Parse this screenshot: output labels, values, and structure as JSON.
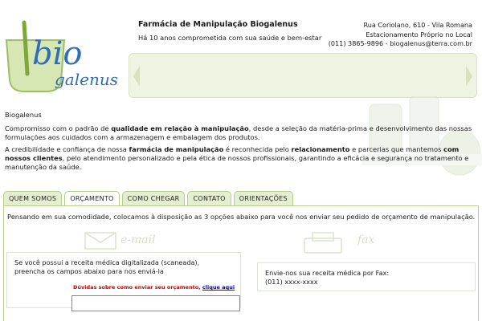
{
  "header": {
    "logo_top": "bio",
    "logo_bottom": "galenus",
    "title": "Farmácia de Manipulação Biogalenus",
    "subtitle": "Há 10 anos comprometida com sua saúde e bem-estar",
    "address_line1": "Rua Coriolano, 610 - Vila Romana",
    "address_line2": "Estacionamento Próprio no Local",
    "address_line3": "(011) 3865-9896 - biogalenus@terra.com.br"
  },
  "intro": {
    "title": "Biogalenus",
    "p1_a": "Compromisso com o padrão de ",
    "p1_b": "qualidade em relação à manipulação",
    "p1_c": ", desde a seleção da matéria-prima e desenvolvimento das nossas formulações aos cuidados com a armazenagem e embalagem dos produtos.",
    "p2_a": "A credibilidade e confiança de nossa ",
    "p2_b": "farmácia de manipulação",
    "p2_c": " é reconhecida pelo ",
    "p2_d": "relacionamento",
    "p2_e": " e parcerias que mantemos ",
    "p2_f": "com nossos clientes",
    "p2_g": ", pelo atendimento personalizado e pela ética de nossos profissionais, garantindo a eficácia e segurança no tratamento e manutenção da saúde."
  },
  "tabs": [
    {
      "label": "QUEM SOMOS"
    },
    {
      "label": "ORÇAMENTO"
    },
    {
      "label": "COMO CHEGAR"
    },
    {
      "label": "CONTATO"
    },
    {
      "label": "ORIENTAÇÕES"
    }
  ],
  "active_tab": "ORÇAMENTO",
  "panel": {
    "intro": "Pensando em sua comodidade, colocamos à disposição as 3 opções abaixo para você nos enviar seu pedido de orçamento de manipulação.",
    "watermark_email": "e-mail",
    "watermark_fax": "fax",
    "email_box_line1": "Se você possui a receita médica digitalizada (scaneada),",
    "email_box_line2": "preencha os campos abaixo para nos enviá-la",
    "help_text": "Dúvidas sobre como enviar seu orçamento, ",
    "help_link": "clique aqui",
    "fax_box_line1": "Envie-nos sua receita médica por Fax:",
    "fax_box_line2": "(011) xxxx-xxxx"
  },
  "colors": {
    "brand_green": "#7fa83a",
    "logo_blue": "#2f6db5",
    "tab_border": "#b8cc8c",
    "help_red": "#cc0000"
  }
}
